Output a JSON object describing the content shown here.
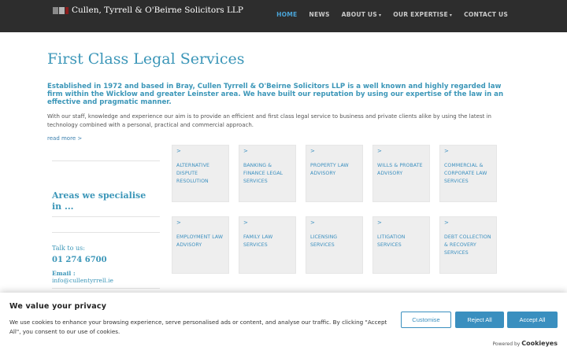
{
  "header": {
    "logo_text": "Cullen, Tyrrell & O'Beirne Solicitors LLP",
    "nav": [
      {
        "label": "HOME",
        "active": true
      },
      {
        "label": "NEWS"
      },
      {
        "label": "ABOUT US",
        "caret": "▾"
      },
      {
        "label": "OUR EXPERTISE",
        "caret": "▾"
      },
      {
        "label": "CONTACT US"
      }
    ]
  },
  "hero": {
    "title": "First Class Legal Services",
    "lead": "Established in 1972 and based in Bray, Cullen Tyrrell & O'Beirne Solicitors LLP is a well known and highly regarded law firm within the Wicklow and greater Leinster area. We have built our reputation by using our expertise of the law in an effective and pragmatic manner.",
    "body": "With our staff, knowledge and experience our aim is to provide an efficient and first class legal service to business and private clients alike by using the latest in technology combined with a personal, practical and commercial approach.",
    "read_more": "read more >"
  },
  "sidebar": {
    "areas_heading": "Areas we specialise in ...",
    "talk_label": "Talk to us:",
    "phone": "01 274 6700",
    "email_label": "Email :",
    "email": "info@cullentyrrell.ie"
  },
  "services": [
    {
      "arrow": ">",
      "label": "ALTERNATIVE DISPUTE RESOLUTION"
    },
    {
      "arrow": ">",
      "label": "BANKING & FINANCE LEGAL SERVICES"
    },
    {
      "arrow": ">",
      "label": "PROPERTY LAW ADVISORY"
    },
    {
      "arrow": ">",
      "label": "WILLS & PROBATE ADVISORY"
    },
    {
      "arrow": ">",
      "label": "COMMERCIAL & CORPORATE LAW SERVICES"
    },
    {
      "arrow": ">",
      "label": "EMPLOYMENT LAW ADVISORY"
    },
    {
      "arrow": ">",
      "label": "FAMILY LAW SERVICES"
    },
    {
      "arrow": ">",
      "label": "LICENSING SERVICES"
    },
    {
      "arrow": ">",
      "label": "LITIGATION SERVICES"
    },
    {
      "arrow": ">",
      "label": "DEBT COLLECTION & RECOVERY SERVICES"
    }
  ],
  "cookie": {
    "title": "We value your privacy",
    "text": "We use cookies to enhance your browsing experience, serve personalised ads or content, and analyse our traffic. By clicking \"Accept All\", you consent to our use of cookies.",
    "customise": "Customise",
    "reject": "Reject All",
    "accept": "Accept All",
    "powered_by": "Powered by",
    "brand": "Cookieyes"
  },
  "colors": {
    "accent": "#3b96b8",
    "header_bg": "#2d2d2d",
    "nav_active": "#4aa3d6",
    "tile_bg": "#eeeeee",
    "button": "#3a8fbf"
  }
}
